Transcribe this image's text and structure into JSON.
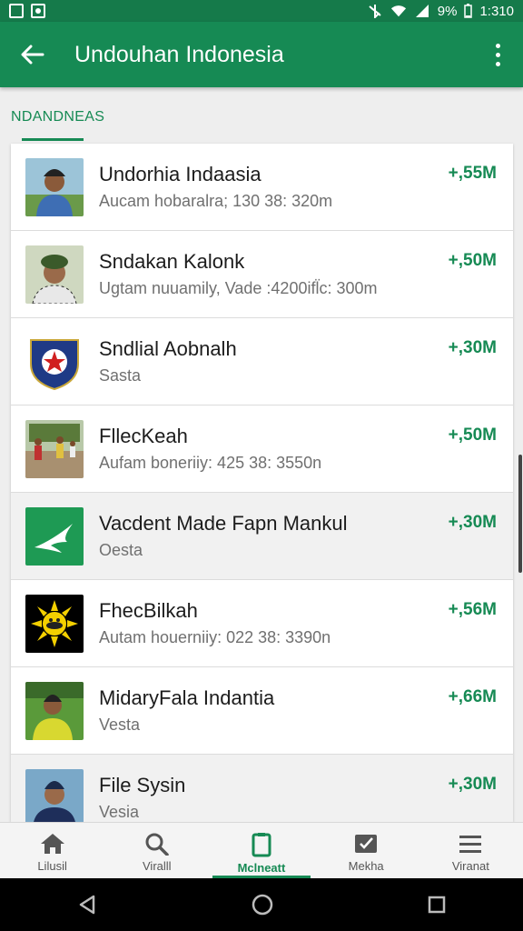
{
  "status_bar": {
    "battery": "9%",
    "time": "1:310"
  },
  "app_bar": {
    "title": "Undouhan Indonesia"
  },
  "section": {
    "title": "NDANDNEAS"
  },
  "items": [
    {
      "title": "Undorhia Indaasia",
      "subtitle": "Aucam hobaralra; 130 38: 320m",
      "size": "+,55M",
      "thumb": "person-blue-shirt"
    },
    {
      "title": "Sndakan Kalonk",
      "subtitle": "Ugtam nuuamily, Vade :4200ifl̈c: 300m",
      "size": "+,50M",
      "thumb": "person-green-hat"
    },
    {
      "title": "Sndlial Aobnalh",
      "subtitle": "Sasta",
      "size": "+,30M",
      "thumb": "emblem-star"
    },
    {
      "title": "FllecKeah",
      "subtitle": "Aufam boneriiy: 425 38: 3550n",
      "size": "+,50M",
      "thumb": "people-outdoors"
    },
    {
      "title": "Vacdent Made Fapn Mankul",
      "subtitle": "Oesta",
      "size": "+,30M",
      "thumb": "green-bird-logo"
    },
    {
      "title": "FhecBilkah",
      "subtitle": "Autam houerniiy: 022 38: 3390n",
      "size": "+,56M",
      "thumb": "sun-emblem"
    },
    {
      "title": "MidaryFala Indantia",
      "subtitle": "Vesta",
      "size": "+,66M",
      "thumb": "person-field"
    },
    {
      "title": "File Sysin",
      "subtitle": "Vesia",
      "size": "+,30M",
      "thumb": "person-blue"
    }
  ],
  "bottom_nav": [
    {
      "label": "Lilusil",
      "icon": "home-icon"
    },
    {
      "label": "Viralll",
      "icon": "search-icon"
    },
    {
      "label": "Mclneatt",
      "icon": "download-icon",
      "active": true
    },
    {
      "label": "Mekha",
      "icon": "media-icon"
    },
    {
      "label": "Viranat",
      "icon": "menu-icon"
    }
  ],
  "colors": {
    "primary": "#168a54",
    "status": "#157a4a"
  }
}
